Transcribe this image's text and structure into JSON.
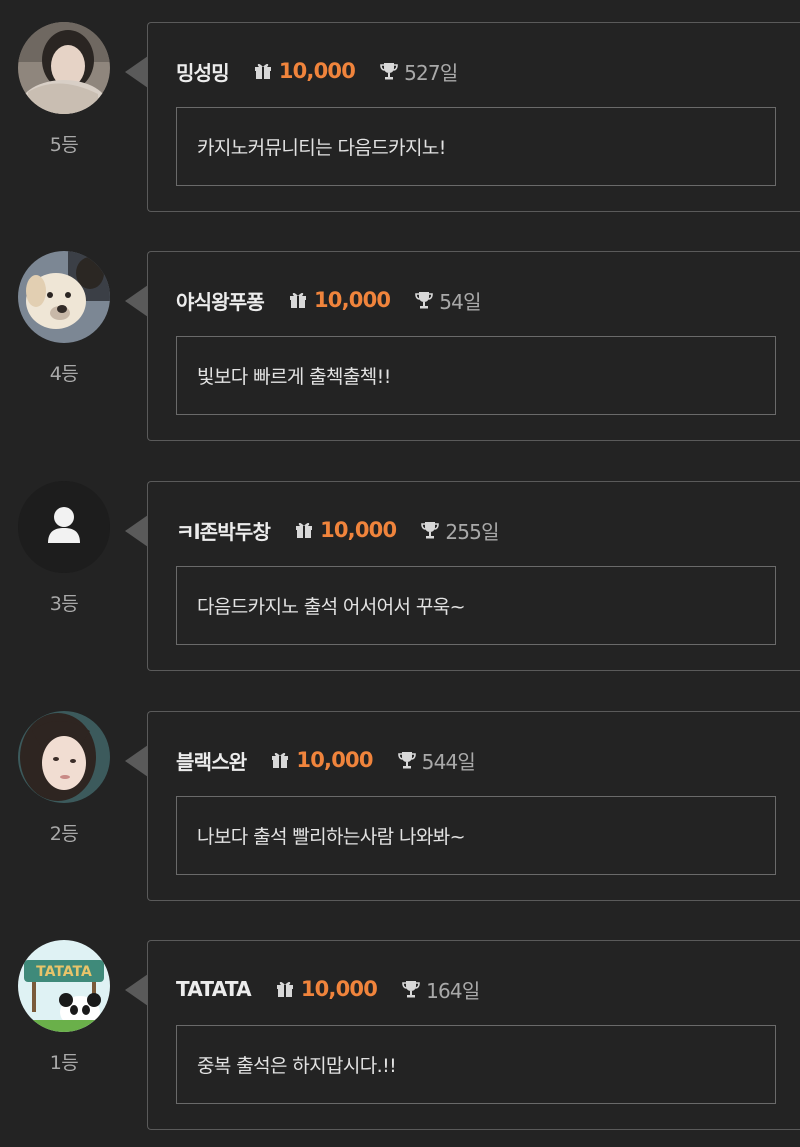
{
  "icons": {
    "points": "gift-icon",
    "streak": "trophy-icon"
  },
  "colors": {
    "points": "#f0843c",
    "background": "#232323",
    "border": "#5a5a5a"
  },
  "entries": [
    {
      "rank": "5등",
      "nickname": "밍성밍",
      "points": "10,000",
      "days": "527일",
      "message": "카지노커뮤니티는 다음드카지노!",
      "avatar": "photo-woman"
    },
    {
      "rank": "4등",
      "nickname": "야식왕푸퐁",
      "points": "10,000",
      "days": "54일",
      "message": "빛보다 빠르게 출첵출첵!!",
      "avatar": "photo-dog"
    },
    {
      "rank": "3등",
      "nickname": "ㅋl존박두창",
      "points": "10,000",
      "days": "255일",
      "message": "다음드카지노 출석 어서어서 꾸욱~",
      "avatar": "default-user"
    },
    {
      "rank": "2등",
      "nickname": "블랙스완",
      "points": "10,000",
      "days": "544일",
      "message": "나보다 출석 빨리하는사람 나와봐~",
      "avatar": "photo-woman"
    },
    {
      "rank": "1등",
      "nickname": "TATATA",
      "points": "10,000",
      "days": "164일",
      "message": "중복 출석은 하지맙시다.!!",
      "avatar": "panda-sign"
    },
    {
      "avatar_text": "TATATA"
    }
  ]
}
